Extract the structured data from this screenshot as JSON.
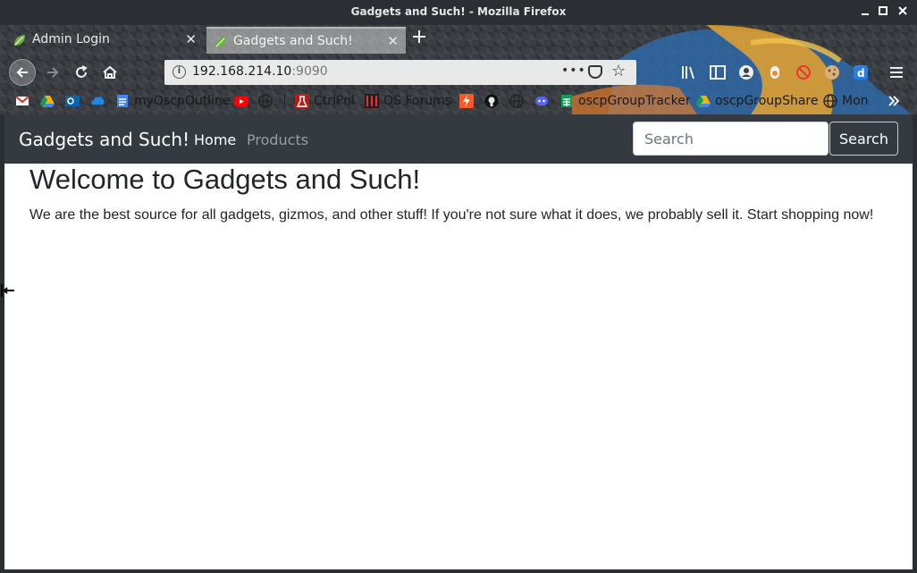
{
  "window": {
    "title": "Gadgets and Such! - Mozilla Firefox"
  },
  "tabs": [
    {
      "label": "Admin Login",
      "active": false
    },
    {
      "label": "Gadgets and Such!",
      "active": true
    }
  ],
  "navbar": {
    "url_host": "192.168.214.10",
    "url_port": ":9090",
    "page_actions": "•••"
  },
  "bookmarks": [
    {
      "label": "",
      "icon": "gmail-icon"
    },
    {
      "label": "",
      "icon": "google-drive-icon"
    },
    {
      "label": "",
      "icon": "outlook-icon"
    },
    {
      "label": "",
      "icon": "onedrive-icon"
    },
    {
      "label": "myOscpOutline",
      "icon": "google-docs-icon"
    },
    {
      "label": "",
      "icon": "youtube-icon"
    },
    {
      "label": "",
      "icon": "globe-icon"
    },
    {
      "label": "CtrlPnl",
      "icon": "ctrlpnl-icon"
    },
    {
      "label": "OS Forums",
      "icon": "os-forums-icon"
    },
    {
      "label": "",
      "icon": "lightning-icon"
    },
    {
      "label": "",
      "icon": "github-icon"
    },
    {
      "label": "",
      "icon": "globe-icon"
    },
    {
      "label": "",
      "icon": "discord-icon"
    },
    {
      "label": "oscpGroupTracker",
      "icon": "google-sheets-icon"
    },
    {
      "label": "oscpGroupShare",
      "icon": "google-drive-icon"
    },
    {
      "label": "Mon",
      "icon": "globe-icon"
    }
  ],
  "site": {
    "brand": "Gadgets and Such!",
    "nav_home": "Home",
    "nav_products": "Products",
    "search_placeholder": "Search",
    "search_button": "Search",
    "heading": "Welcome to Gadgets and Such!",
    "intro": "We are the best source for all gadgets, gizmos, and other stuff! If you're not sure what it does, we probably sell it. Start shopping now!"
  },
  "colors": {
    "site_navbar": "#343a40",
    "browser_chrome": "#2b2e33",
    "link_inactive": "#9a9da0"
  }
}
